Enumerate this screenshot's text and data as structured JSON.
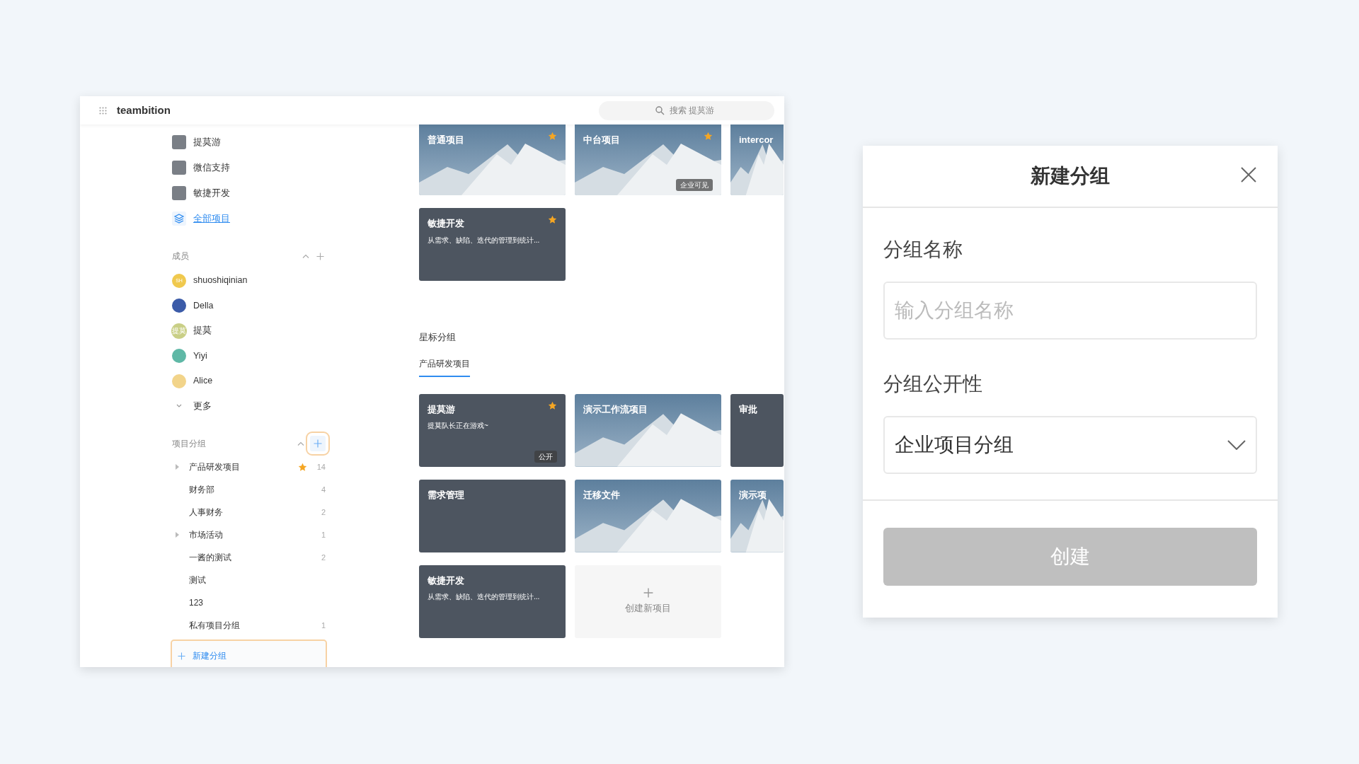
{
  "header": {
    "logo": "teambition",
    "search": {
      "placeholder": "搜索 提莫游"
    }
  },
  "sidebar": {
    "projects": [
      {
        "name": "提莫游",
        "kind": "project"
      },
      {
        "name": "微信支持",
        "kind": "project"
      },
      {
        "name": "敏捷开发",
        "kind": "project"
      },
      {
        "name": "全部项目",
        "kind": "all"
      }
    ],
    "members": {
      "title": "成员",
      "items": [
        {
          "name": "shuoshiqinian",
          "initials": "SH",
          "color": "#f0c94e"
        },
        {
          "name": "Della",
          "color": "#3b5ba8"
        },
        {
          "name": "提莫",
          "initials": "提莫",
          "color": "#c9cf86"
        },
        {
          "name": "Yiyi",
          "color": "#5fb8a6"
        },
        {
          "name": "Alice",
          "color": "#f2d48a"
        }
      ],
      "more": "更多"
    },
    "groups": {
      "title": "项目分组",
      "add_highlighted": true,
      "items": [
        {
          "name": "产品研发项目",
          "expandable": true,
          "starred": true,
          "count": "14"
        },
        {
          "name": "财务部",
          "expandable": false,
          "starred": false,
          "count": "4"
        },
        {
          "name": "人事财务",
          "expandable": false,
          "starred": false,
          "count": "2"
        },
        {
          "name": "市场活动",
          "expandable": true,
          "starred": false,
          "count": "1"
        },
        {
          "name": "一酱的测试",
          "expandable": false,
          "starred": false,
          "count": "2"
        },
        {
          "name": "测试",
          "expandable": false,
          "starred": false
        },
        {
          "name": "123",
          "expandable": false,
          "starred": false
        },
        {
          "name": "私有项目分组",
          "expandable": false,
          "starred": false,
          "count": "1"
        }
      ],
      "new_group": {
        "label": "新建分组",
        "highlighted": true
      }
    }
  },
  "main": {
    "top_cards": [
      {
        "kind": "mountain",
        "title": "普通项目",
        "starred": true
      },
      {
        "kind": "mountain",
        "title": "中台项目",
        "starred": true,
        "badge": "企业可见"
      },
      {
        "kind": "mountain",
        "title": "intercor",
        "starred": false
      },
      {
        "kind": "photo",
        "title": "敏捷开发",
        "subtitle": "从需求、缺陷、迭代的管理到统计...",
        "starred": true
      }
    ],
    "starred_section": {
      "title": "星标分组",
      "tabs": [
        {
          "label": "产品研发项目",
          "selected": true
        }
      ],
      "cards": [
        {
          "kind": "photo",
          "title": "提莫游",
          "subtitle": "提莫队长正在游戏~",
          "starred": true,
          "badge": "公开"
        },
        {
          "kind": "mountain",
          "title": "演示工作流项目",
          "starred": false
        },
        {
          "kind": "photo",
          "title": "审批",
          "starred": false
        },
        {
          "kind": "photo",
          "title": "需求管理",
          "starred": false
        },
        {
          "kind": "mountain",
          "title": "迁移文件",
          "starred": false
        },
        {
          "kind": "mountain",
          "title": "演示项",
          "starred": false
        },
        {
          "kind": "photo",
          "title": "敏捷开发",
          "subtitle": "从需求、缺陷、迭代的管理到统计...",
          "starred": false
        },
        {
          "kind": "create",
          "title": "创建新项目"
        }
      ]
    }
  },
  "dialog": {
    "title": "新建分组",
    "fields": [
      {
        "kind": "input",
        "label": "分组名称",
        "placeholder": "输入分组名称"
      },
      {
        "kind": "select",
        "label": "分组公开性",
        "value": "企业项目分组"
      }
    ],
    "button": {
      "label": "创建",
      "disabled": true
    }
  }
}
